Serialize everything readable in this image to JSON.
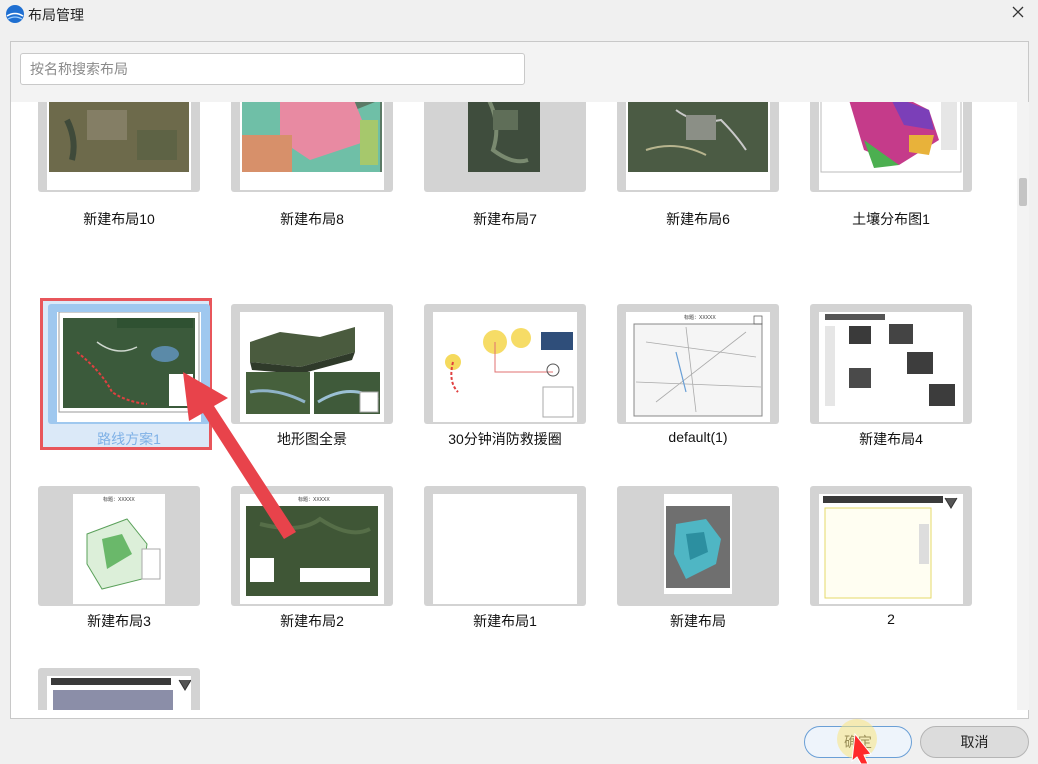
{
  "window": {
    "title": "布局管理"
  },
  "search": {
    "placeholder": "按名称搜索布局",
    "value": ""
  },
  "layouts": [
    {
      "label": "新建布局10",
      "selected": false
    },
    {
      "label": "新建布局8",
      "selected": false
    },
    {
      "label": "新建布局7",
      "selected": false
    },
    {
      "label": "新建布局6",
      "selected": false
    },
    {
      "label": "土壤分布图1",
      "selected": false
    },
    {
      "label": "路线方案1",
      "selected": true
    },
    {
      "label": "地形图全景",
      "selected": false
    },
    {
      "label": "30分钟消防救援圈",
      "selected": false
    },
    {
      "label": "default(1)",
      "selected": false
    },
    {
      "label": "新建布局4",
      "selected": false
    },
    {
      "label": "新建布局3",
      "selected": false
    },
    {
      "label": "新建布局2",
      "selected": false
    },
    {
      "label": "新建布局1",
      "selected": false
    },
    {
      "label": "新建布局",
      "selected": false
    },
    {
      "label": "2",
      "selected": false
    },
    {
      "label": "",
      "selected": false
    }
  ],
  "thumb_text": {
    "title_xxxxx": "标题：XXXXX"
  },
  "buttons": {
    "ok": "确定",
    "cancel": "取消"
  },
  "colors": {
    "selection_border": "#e8565b",
    "selection_fill": "#9fc8ef",
    "arrow": "#e8434b",
    "ok_border": "#6a9fd6"
  },
  "icons": {
    "app": "app-logo-icon",
    "close": "close-icon"
  }
}
